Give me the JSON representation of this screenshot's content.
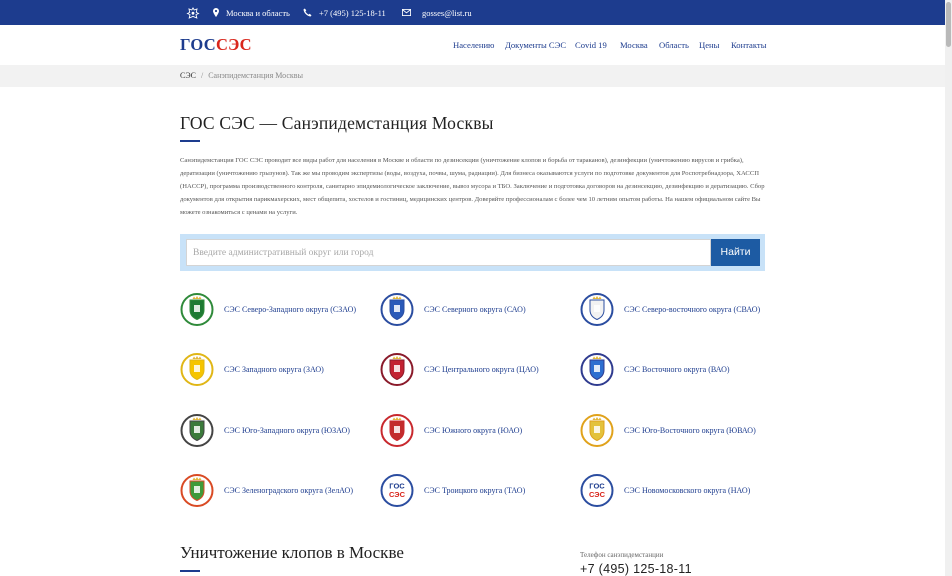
{
  "topbar": {
    "region": "Москва и область",
    "phone": "+7 (495) 125-18-11",
    "email": "gosses@list.ru",
    "bg_color": "#1d3c8e"
  },
  "header": {
    "logo_part1": "ГОС",
    "logo_part2": "СЭС",
    "nav": [
      "Населению",
      "Документы СЭС",
      "Covid 19",
      "Москва",
      "Область",
      "Цены",
      "Контакты"
    ]
  },
  "breadcrumb": {
    "home": "СЭС",
    "separator": "/",
    "current": "Санэпидемстанция Москвы"
  },
  "main": {
    "title": "ГОС СЭС — Санэпидемстанция Москвы",
    "intro": "Санэпидемстанция ГОС СЭС проводит все виды работ для населения в Москве и области по дезинсекции (уничтожение клопов и борьба от тараканов), дезинфекции (уничтожению вирусов и грибка), дератизации (уничтожению грызунов). Так же мы проводим экспертизы (воды, воздуха, почвы, шума, радиации). Для бизнеса оказываются услуги по подготовке документов для Роспотребнадзора, ХАССП (HACCP), программа производственного контроля, санитарно эпидемиологическое заключение, вывоз мусора и ТБО. Заключение и подготовка договоров на дезинсекцию, дезинфекцию и дератизацию. Сбор документов для открытия парикмахерских, мест общепита, хостелов и гостиниц, медицинских центров. Доверяйте профессионалам с более чем 10 летним опытом работы. На нашем официальном сайте Вы можете ознакомиться с ценами на услуги.",
    "search_placeholder": "Введите административный округ или город",
    "search_button": "Найти",
    "districts": [
      "СЭС Северо-Западного округа (СЗАО)",
      "СЭС Северного округа (САО)",
      "СЭС Северо-восточного округа (СВАО)",
      "СЭС Западного округа (ЗАО)",
      "СЭС Центрального округа (ЦАО)",
      "СЭС Восточного округа (ВАО)",
      "СЭС Юго-Западного округа (ЮЗАО)",
      "СЭС Южного округа (ЮАО)",
      "СЭС Юго-Восточного округа (ЮВАО)",
      "СЭС Зеленоградского округа (ЗелАО)",
      "СЭС Троицкого округа (ТАО)",
      "СЭС Новомосковского округа (НАО)"
    ],
    "emblem_text_top": "ГОС",
    "emblem_text_bottom": "СЭС",
    "section_title": "Уничтожение клопов в Москве",
    "side_label": "Телефон санэпидемстанции",
    "side_phone": "+7 (495) 125-18-11"
  },
  "colors": {
    "brand_blue": "#1d3c8e",
    "brand_red": "#d9261c",
    "button_blue": "#1d5ba3",
    "search_frame": "#c8e2f8"
  },
  "icons": {
    "emblem": "coat-of-arms-icon",
    "region": "map-pin-icon",
    "phone": "phone-icon",
    "email": "mail-icon"
  }
}
